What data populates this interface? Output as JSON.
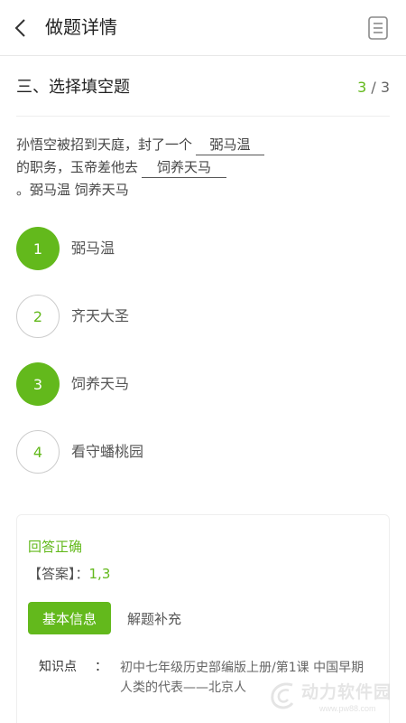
{
  "header": {
    "title": "做题详情",
    "back_icon": "chevron-left-icon",
    "menu_icon": "document-list-icon"
  },
  "section": {
    "title": "三、选择填空题",
    "progress_current": "3",
    "progress_separator": " / ",
    "progress_total": "3"
  },
  "question": {
    "part1": "孙悟空被招到天庭，封了一个",
    "blank1": "弼马温",
    "part2": "的职务，玉帝差他去",
    "blank2": "饲养天马",
    "part3": "。弼马温 饲养天马"
  },
  "options": [
    {
      "number": "1",
      "text": "弼马温",
      "selected": true
    },
    {
      "number": "2",
      "text": "齐天大圣",
      "selected": false
    },
    {
      "number": "3",
      "text": "饲养天马",
      "selected": true
    },
    {
      "number": "4",
      "text": "看守蟠桃园",
      "selected": false
    }
  ],
  "answer": {
    "result": "回答正确",
    "label": "【答案】：",
    "value": "1,3"
  },
  "tabs": {
    "basic": "基本信息",
    "solution": "解题补充"
  },
  "knowledge": {
    "label": "知识点",
    "colon": "：",
    "value": "初中七年级历史部编版上册/第1课 中国早期人类的代表——北京人"
  },
  "watermark": {
    "text": "动力软件园",
    "url": "www.pw88.com"
  },
  "colors": {
    "accent": "#63b91c",
    "text": "#333333",
    "muted": "#555555",
    "border": "#eeeeee"
  }
}
